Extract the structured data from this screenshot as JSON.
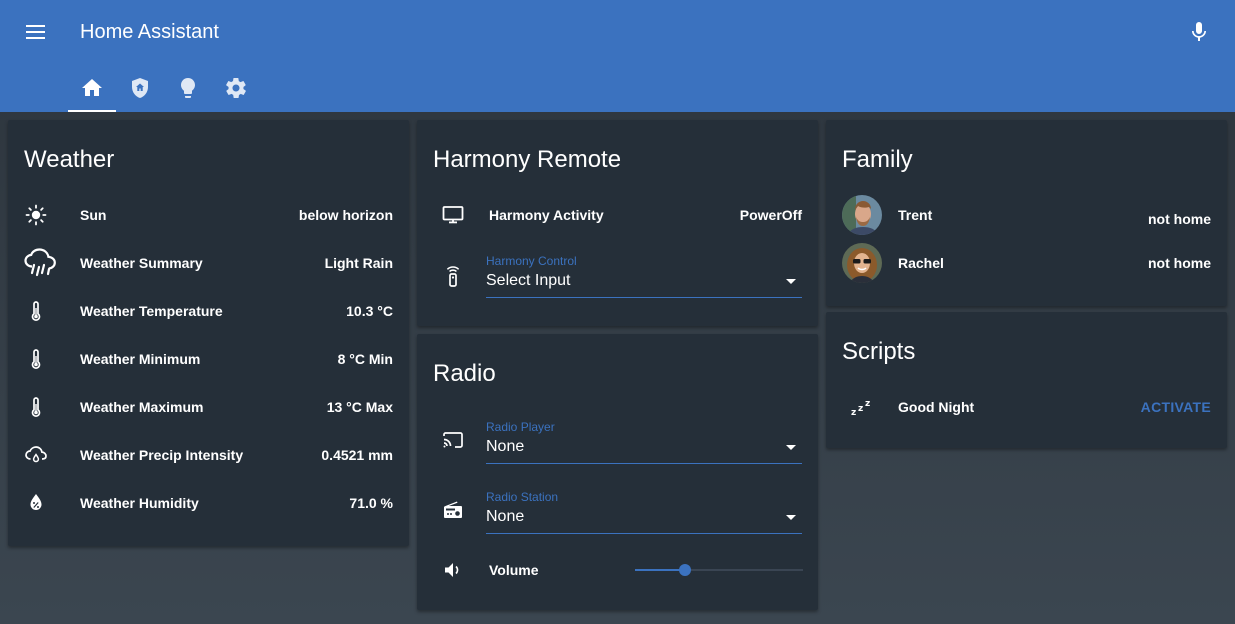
{
  "app": {
    "title": "Home Assistant"
  },
  "colors": {
    "accent": "#3b72bf",
    "card": "#252f39",
    "header": "#3b72bf"
  },
  "tabs": [
    {
      "icon": "home-icon",
      "active": true
    },
    {
      "icon": "home-shield-icon",
      "active": false
    },
    {
      "icon": "lightbulb-icon",
      "active": false
    },
    {
      "icon": "gear-icon",
      "active": false
    }
  ],
  "weather": {
    "title": "Weather",
    "rows": [
      {
        "icon": "sun-icon",
        "name": "Sun",
        "state": "below horizon"
      },
      {
        "icon": "rain-cloud-icon",
        "name": "Weather Summary",
        "state": "Light Rain"
      },
      {
        "icon": "thermometer-icon",
        "name": "Weather Temperature",
        "state": "10.3 °C"
      },
      {
        "icon": "thermometer-icon",
        "name": "Weather Minimum",
        "state": "8 °C Min"
      },
      {
        "icon": "thermometer-icon",
        "name": "Weather Maximum",
        "state": "13 °C Max"
      },
      {
        "icon": "cloud-drop-icon",
        "name": "Weather Precip Intensity",
        "state": "0.4521 mm"
      },
      {
        "icon": "humidity-icon",
        "name": "Weather Humidity",
        "state": "71.0 %"
      }
    ]
  },
  "harmony": {
    "title": "Harmony Remote",
    "activity": {
      "icon": "monitor-icon",
      "name": "Harmony Activity",
      "state": "PowerOff"
    },
    "control": {
      "icon": "remote-icon",
      "label": "Harmony Control",
      "value": "Select Input"
    }
  },
  "radio": {
    "title": "Radio",
    "player": {
      "icon": "cast-icon",
      "label": "Radio Player",
      "value": "None"
    },
    "station": {
      "icon": "radio-icon",
      "label": "Radio Station",
      "value": "None"
    },
    "volume": {
      "icon": "volume-icon",
      "name": "Volume",
      "level": 0.3
    }
  },
  "family": {
    "title": "Family",
    "members": [
      {
        "name": "Trent",
        "state": "not home"
      },
      {
        "name": "Rachel",
        "state": "not home"
      }
    ]
  },
  "scripts": {
    "title": "Scripts",
    "items": [
      {
        "icon": "sleep-icon",
        "name": "Good Night",
        "action": "ACTIVATE"
      }
    ]
  }
}
